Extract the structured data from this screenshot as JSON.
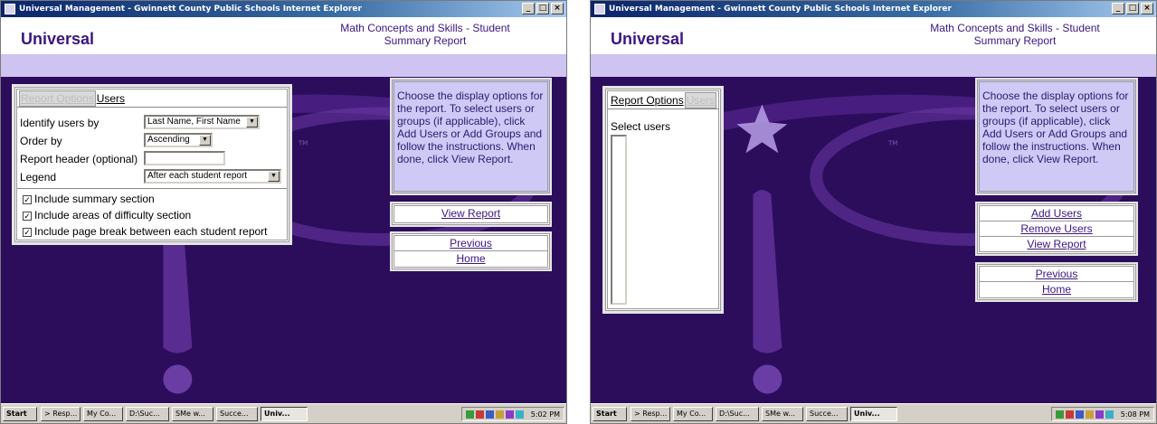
{
  "colors": {
    "window_title_start": "#0a246a",
    "window_title_end": "#a6caf0",
    "brand_purple": "#3b1680",
    "background": "#2c0d5c",
    "band": "#cfc3f2",
    "help_box": "#cfcaf5",
    "taskbar": "#d4d0c8"
  },
  "left": {
    "window": {
      "title": "Universal Management - Gwinnett County Public Schools Internet Explorer",
      "controls": [
        "_",
        "□",
        "×"
      ]
    },
    "header": {
      "logo": "Universal",
      "report_title": "Math Concepts and Skills - Student Summary Report",
      "tm": "TM"
    },
    "tabs": {
      "report_options": "Report Options",
      "users": "Users"
    },
    "form": {
      "identify_label": "Identify users by",
      "identify_value": "Last Name, First Name",
      "order_label": "Order by",
      "order_value": "Ascending",
      "header_label": "Report header (optional)",
      "header_value": "",
      "legend_label": "Legend",
      "legend_value": "After each student report",
      "checks": [
        {
          "label": "Include summary section",
          "checked": true
        },
        {
          "label": "Include areas of difficulty section",
          "checked": true
        },
        {
          "label": "Include page break between each student report",
          "checked": true
        }
      ]
    },
    "help": "Choose the display options for the report. To select users or groups (if applicable), click Add Users or Add Groups and follow the instructions. When done, click View Report.",
    "actions": {
      "view_report": "View Report"
    },
    "nav": {
      "previous": "Previous",
      "home": "Home"
    },
    "taskbar": {
      "start": "Start",
      "items": [
        "> Resp...",
        "My Co...",
        "D:\\Suc...",
        "SMe w...",
        "Succe...",
        "Univ..."
      ],
      "active_index": 5,
      "clock": "5:02 PM"
    }
  },
  "right": {
    "window": {
      "title": "Universal Management - Gwinnett County Public Schools Internet Explorer",
      "controls": [
        "_",
        "□",
        "×"
      ]
    },
    "header": {
      "logo": "Universal",
      "report_title": "Math Concepts and Skills - Student Summary Report",
      "tm": "TM"
    },
    "tabs": {
      "report_options": "Report Options",
      "users": "Users"
    },
    "select_users": "Select users",
    "help": "Choose the display options for the report. To select users or groups (if applicable), click Add Users or Add Groups and follow the instructions. When done, click View Report.",
    "actions": {
      "add_users": "Add Users",
      "remove_users": "Remove Users",
      "view_report": "View Report"
    },
    "nav": {
      "previous": "Previous",
      "home": "Home"
    },
    "taskbar": {
      "start": "Start",
      "items": [
        "> Resp...",
        "My Co...",
        "D:\\Suc...",
        "SMe w...",
        "Succe...",
        "Univ..."
      ],
      "active_index": 5,
      "clock": "5:08 PM"
    }
  }
}
